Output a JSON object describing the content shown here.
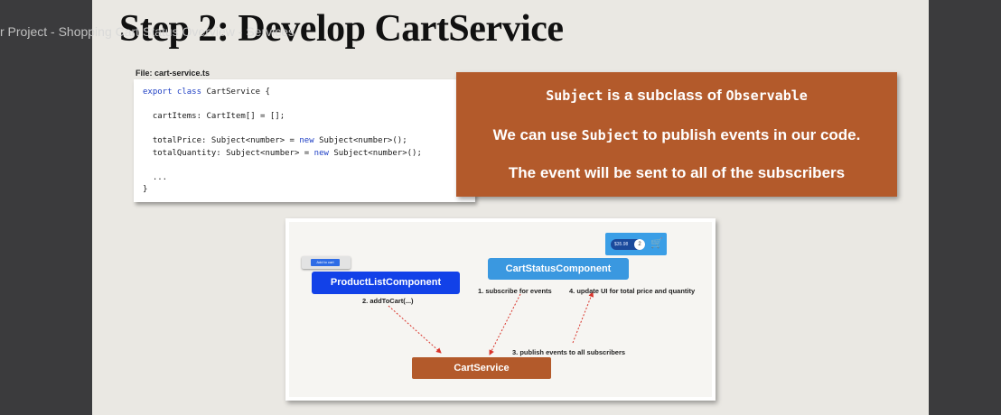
{
  "video": {
    "title": "r Project - Shopping Cart Status Overview - Services"
  },
  "slide": {
    "title": "Step 2: Develop CartService"
  },
  "code": {
    "file_label": "File: cart-service.ts",
    "line1_kw": "export class",
    "line1_rest": " CartService {",
    "line2": "  cartItems: CartItem[] = [];",
    "line3_a": "  totalPrice: Subject<number> = ",
    "line3_kw": "new",
    "line3_b": " Subject<number>();",
    "line4_a": "  totalQuantity: Subject<number> = ",
    "line4_kw": "new",
    "line4_b": " Subject<number>();",
    "line5": "  ...",
    "line6": "}"
  },
  "callout": {
    "line1_code_a": "Subject",
    "line1_text": " is a subclass of ",
    "line1_code_b": "Observable",
    "line2_pre": "We can use ",
    "line2_code": "Subject",
    "line2_post": " to publish events in our code.",
    "line3": "The event will be sent to all of the subscribers"
  },
  "diagram": {
    "mini_button": "Add to cart",
    "product_list": "ProductListComponent",
    "cart_status": "CartStatusComponent",
    "cart_service": "CartService",
    "note_add": "2. addToCart(...)",
    "note_subscribe": "1. subscribe for events",
    "note_update": "4. update UI for total price and quantity",
    "note_publish": "3. publish events to all subscribers",
    "widget_price": "$35.98",
    "widget_count": "2",
    "widget_icon": "cart-icon"
  },
  "colors": {
    "accent_orange": "#b35a2b",
    "product_blue": "#1241e8",
    "status_blue": "#3a98e0",
    "arrow_red": "#d9342b"
  }
}
